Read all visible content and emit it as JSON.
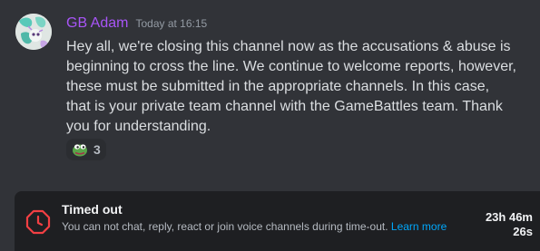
{
  "message": {
    "author": "GB Adam",
    "author_color": "#a855f7",
    "timestamp": "Today at 16:15",
    "content_lines": [
      "Hey all, we're closing this channel now as the accusations & abuse is",
      "beginning to cross the line. We continue to welcome reports, however,",
      "these must be submitted in the appropriate channels. In this case,",
      "that is your private team channel with the GameBattles team. Thank",
      "you for understanding."
    ],
    "reaction": {
      "emoji": "pepe-frog-emoji",
      "count": "3"
    }
  },
  "timeout": {
    "title": "Timed out",
    "description": "You can not chat, reply, react or join voice channels during time-out.",
    "learn_more": "Learn more",
    "timer_lines": [
      "23h 46m",
      "26s"
    ],
    "icon": "timeout-clock-icon",
    "icon_color": "#f23f43"
  },
  "colors": {
    "background": "#313338",
    "bar_background": "#1e1f22",
    "link": "#00a8fc"
  }
}
